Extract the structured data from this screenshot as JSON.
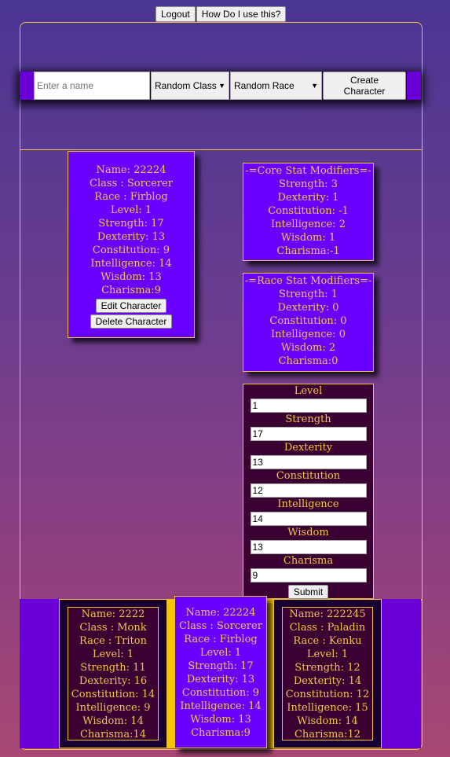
{
  "header": {
    "logout_label": "Logout",
    "help_label": "How Do I use this?"
  },
  "create": {
    "name_placeholder": "Enter a name",
    "class_value": "Random Class",
    "race_value": "Random Race",
    "create_label": "Create Character"
  },
  "character": {
    "name": "Name: 22224",
    "class": "Class : Sorcerer",
    "race": "Race : Firblog",
    "level": "Level: 1",
    "strength": "Strength: 17",
    "dexterity": "Dexterity: 13",
    "constitution": "Constitution: 9",
    "intelligence": "Intelligence: 14",
    "wisdom": "Wisdom: 13",
    "charisma": "Charisma:9",
    "edit_label": "Edit Character",
    "delete_label": "Delete Character"
  },
  "core_mods": {
    "title": "-=Core Stat Modifiers=-",
    "strength": "Strength: 3",
    "dexterity": "Dexterity: 1",
    "constitution": "Constitution: -1",
    "intelligence": "Intelligence: 2",
    "wisdom": "Wisdom: 1",
    "charisma": "Charisma:-1"
  },
  "race_mods": {
    "title": "-=Race Stat Modifiers=-",
    "strength": "Strength: 1",
    "dexterity": "Dexterity: 0",
    "constitution": "Constitution: 0",
    "intelligence": "Intelligence: 0",
    "wisdom": "Wisdom: 2",
    "charisma": "Charisma:0"
  },
  "form": {
    "level_label": "Level",
    "level_value": "1",
    "strength_label": "Strength",
    "strength_value": "17",
    "dexterity_label": "Dexterity",
    "dexterity_value": "13",
    "constitution_label": "Constitution",
    "constitution_value": "12",
    "intelligence_label": "Intelligence",
    "intelligence_value": "14",
    "wisdom_label": "Wisdom",
    "wisdom_value": "13",
    "charisma_label": "Charisma",
    "charisma_value": "9",
    "submit_label": "Submit"
  },
  "roster": [
    {
      "name": "Name: 2222",
      "class": "Class : Monk",
      "race": "Race : Triton",
      "level": "Level: 1",
      "strength": "Strength: 11",
      "dexterity": "Dexterity: 16",
      "constitution": "Constitution: 14",
      "intelligence": "Intelligence: 9",
      "wisdom": "Wisdom: 14",
      "charisma": "Charisma:14"
    },
    {
      "name": "Name: 22224",
      "class": "Class : Sorcerer",
      "race": "Race : Firblog",
      "level": "Level: 1",
      "strength": "Strength: 17",
      "dexterity": "Dexterity: 13",
      "constitution": "Constitution: 9",
      "intelligence": "Intelligence: 14",
      "wisdom": "Wisdom: 13",
      "charisma": "Charisma:9"
    },
    {
      "name": "Name: 222245",
      "class": "Class : Paladin",
      "race": "Race : Kenku",
      "level": "Level: 1",
      "strength": "Strength: 12",
      "dexterity": "Dexterity: 14",
      "constitution": "Constitution: 12",
      "intelligence": "Intelligence: 15",
      "wisdom": "Wisdom: 14",
      "charisma": "Charisma:12"
    }
  ],
  "colors": {
    "card_purple": "#6a00ff",
    "card_dark": "#3a0032",
    "accent_gold": "#f0c040",
    "text_gold": "#f3c64a"
  },
  "icons": {
    "dropdown": "dropdown-arrow-icon"
  }
}
